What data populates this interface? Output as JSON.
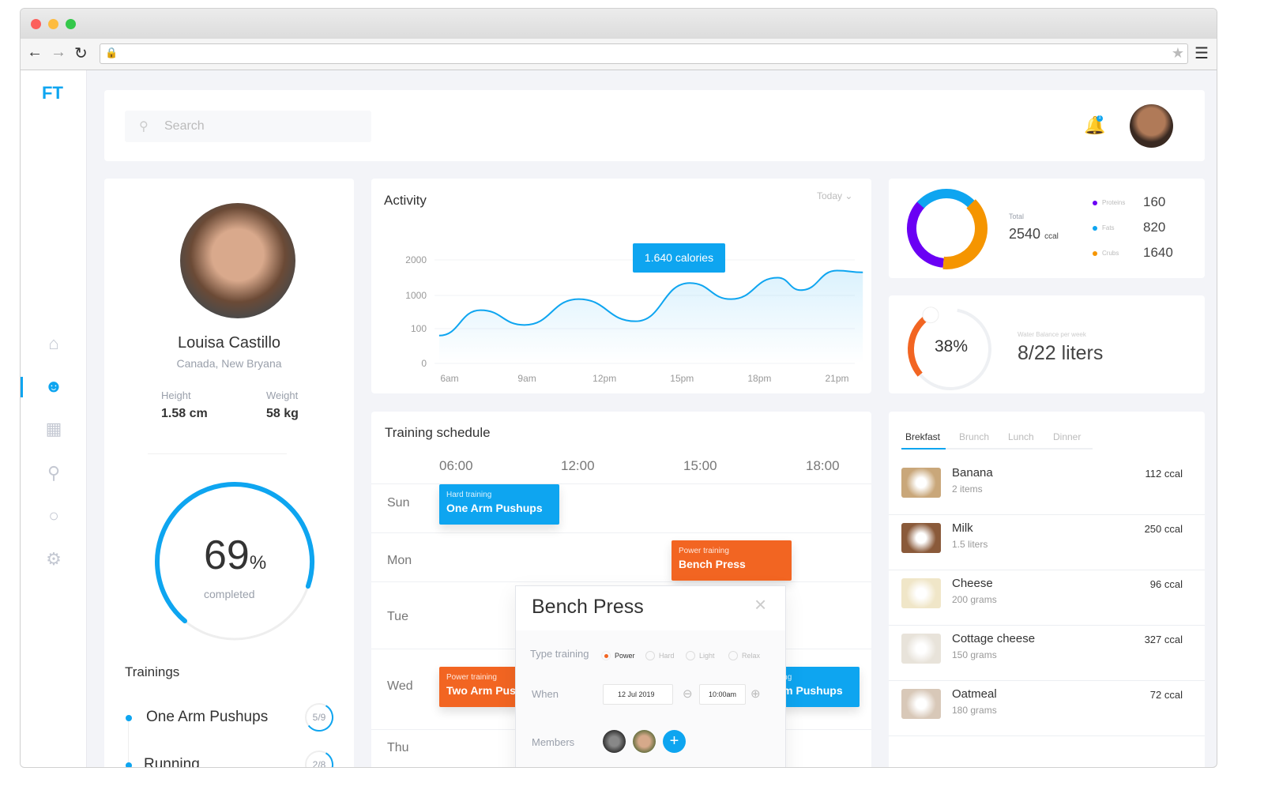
{
  "app": {
    "logo": "FT"
  },
  "search": {
    "placeholder": "Search"
  },
  "header": {
    "notification_count": "1"
  },
  "profile": {
    "name": "Louisa Castillo",
    "location": "Canada, New Bryana",
    "height_label": "Height",
    "height": "1.58 cm",
    "weight_label": "Weight",
    "weight": "58 kg",
    "progress_percent": 69,
    "progress_value": "69",
    "progress_unit": "%",
    "progress_label": "completed"
  },
  "trainings": {
    "title": "Trainings",
    "items": [
      {
        "name": "One Arm Pushups",
        "progress": "5/9",
        "fraction": 0.56
      },
      {
        "name": "Running",
        "progress": "2/8",
        "fraction": 0.25
      }
    ]
  },
  "activity": {
    "title": "Activity",
    "period": "Today",
    "tooltip": "1.640 calories",
    "chart_data": {
      "type": "area",
      "x_ticks": [
        "6am",
        "9am",
        "12pm",
        "15pm",
        "18pm",
        "21pm"
      ],
      "y_ticks": [
        "2000",
        "1000",
        "100",
        "0"
      ],
      "x_hours": [
        5.6,
        7.2,
        8.9,
        11,
        13.2,
        15.3,
        16.9,
        18.7,
        19.6,
        21,
        22
      ],
      "values": [
        80,
        600,
        200,
        900,
        300,
        1350,
        900,
        1500,
        1150,
        1700,
        1650
      ],
      "color": "#0ea5f0"
    }
  },
  "nutrition": {
    "total_label": "Total",
    "total": "2540",
    "unit": "ccal",
    "items": [
      {
        "label": "Proteins",
        "value": "160",
        "color": "#6a00f4"
      },
      {
        "label": "Fats",
        "value": "820",
        "color": "#0ea5f0"
      },
      {
        "label": "Crubs",
        "value": "1640",
        "color": "#f59500"
      }
    ]
  },
  "water": {
    "percent": "38%",
    "fraction": 0.38,
    "label": "Water Balance per week",
    "value": "8/22 liters",
    "color": "#f26522"
  },
  "schedule": {
    "title": "Training schedule",
    "times": [
      "06:00",
      "12:00",
      "15:00",
      "18:00"
    ],
    "days": [
      "Sun",
      "Mon",
      "Tue",
      "Wed",
      "Thu"
    ],
    "events": [
      {
        "type": "Hard training",
        "name": "One Arm Pushups"
      },
      {
        "type": "Power training",
        "name": "Bench Press"
      },
      {
        "type": "Power training",
        "name": "Two Arm Pushups"
      },
      {
        "type": "Hard training",
        "name": "One Arm Pushups"
      }
    ]
  },
  "modal": {
    "title": "Bench Press",
    "type_label": "Type training",
    "types": [
      "Power",
      "Hard",
      "Light",
      "Relax"
    ],
    "selected_type": "Power",
    "when_label": "When",
    "date": "12 Jul 2019",
    "time": "10:00am",
    "members_label": "Members"
  },
  "meals": {
    "tabs": [
      "Brekfast",
      "Brunch",
      "Lunch",
      "Dinner"
    ],
    "active_tab": "Brekfast",
    "items": [
      {
        "name": "Banana",
        "qty": "2 items",
        "cal": "112 ccal"
      },
      {
        "name": "Milk",
        "qty": "1.5 liters",
        "cal": "250 ccal"
      },
      {
        "name": "Cheese",
        "qty": "200 grams",
        "cal": "96 ccal"
      },
      {
        "name": "Cottage cheese",
        "qty": "150 grams",
        "cal": "327 ccal"
      },
      {
        "name": "Oatmeal",
        "qty": "180 grams",
        "cal": "72 ccal"
      }
    ]
  },
  "colors": {
    "accent": "#0ea5f0",
    "orange": "#f26522"
  }
}
